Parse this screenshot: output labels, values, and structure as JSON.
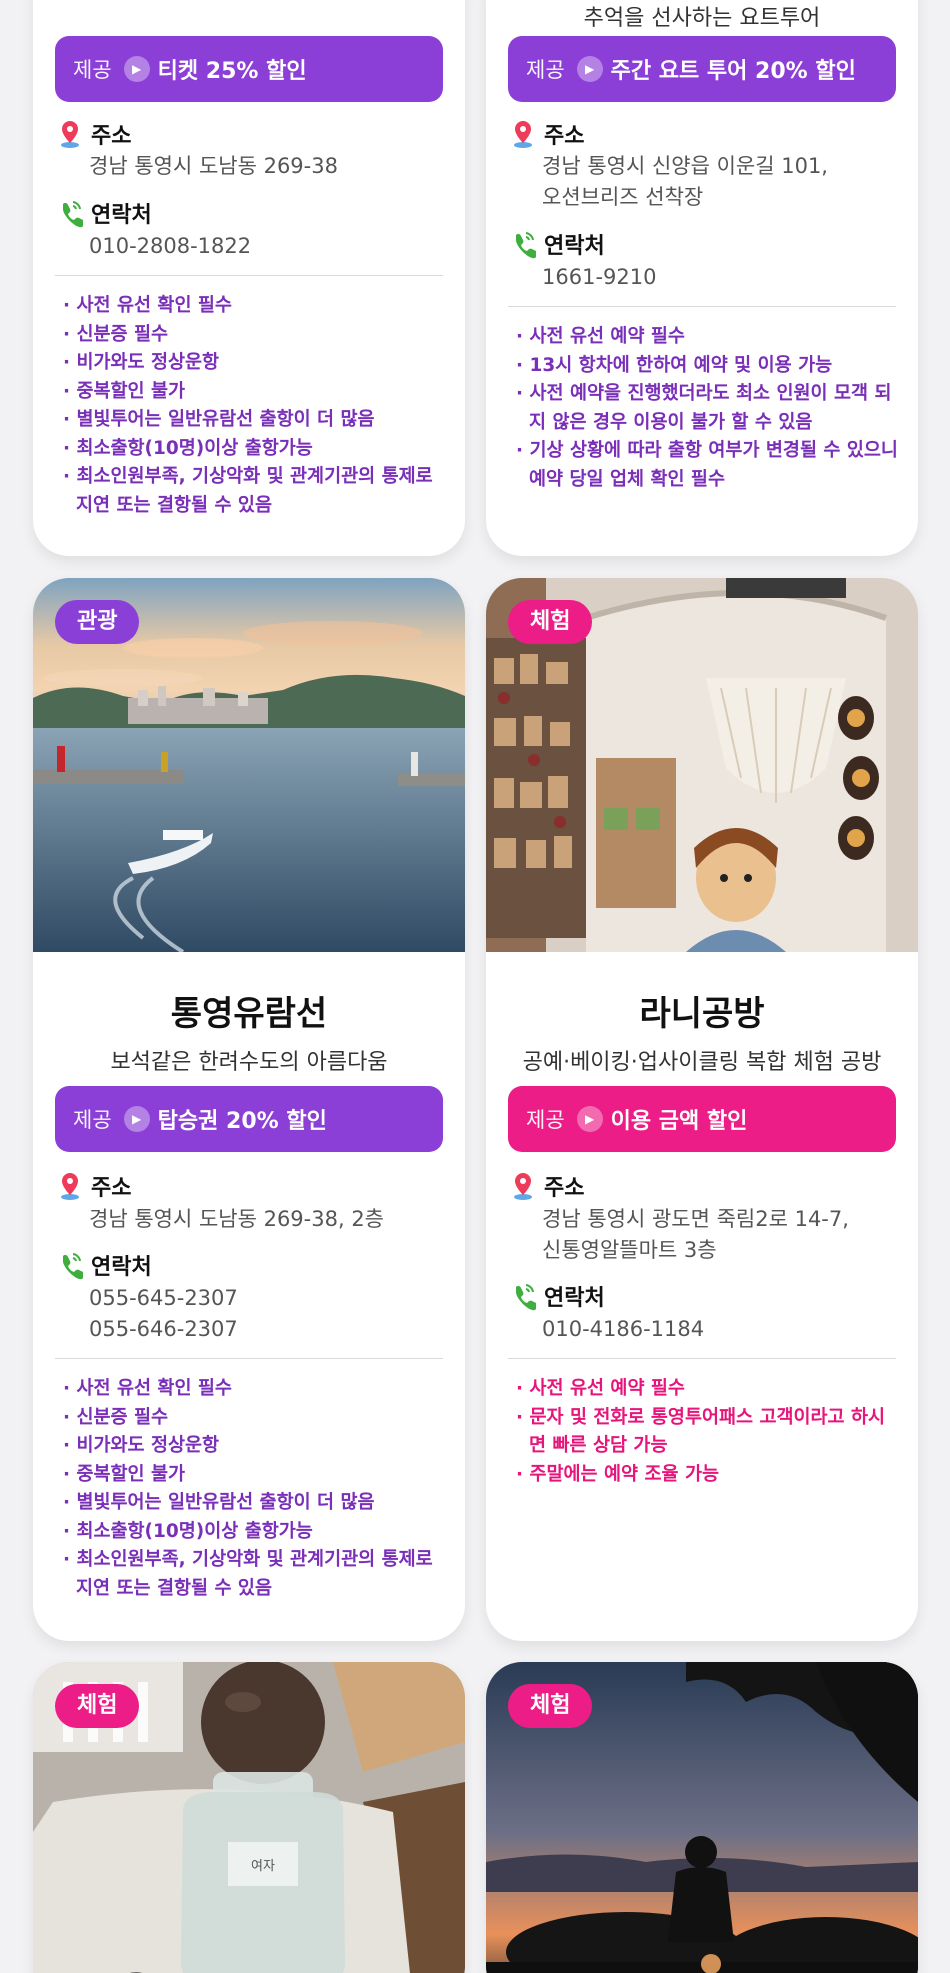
{
  "colors": {
    "purple": "#8b3fd6",
    "pink": "#ec1d87",
    "note_purple": "#7a2fb8",
    "note_pink": "#e6157c"
  },
  "labels": {
    "offer": "제공",
    "address": "주소",
    "contact": "연락처"
  },
  "cards": [
    {
      "subtitle": "추억을 선사하는 요트투어",
      "offer": "주간 요트 투어 20% 할인",
      "address": [
        "경남 통영시 신양읍 이운길 101,",
        "오션브리즈 선착장"
      ],
      "contact": [
        "1661-9210"
      ],
      "notes": [
        "사전 유선 예약 필수",
        "13시 항차에 한하여 예약 및 이용 가능",
        "사전 예약을 진행했더라도 최소 인원이 모객 되지 않은 경우 이용이 불가 할 수 있음",
        "기상 상황에 따라 출항 여부가 변경될 수 있으니 예약 당일 업체 확인 필수"
      ]
    },
    {
      "offer": "티켓 25% 할인",
      "address": [
        "경남 통영시 도남동 269-38"
      ],
      "contact": [
        "010-2808-1822"
      ],
      "notes": [
        "사전 유선 확인 필수",
        "신분증 필수",
        "비가와도 정상운항",
        "중복할인 불가",
        "별빛투어는 일반유람선 출항이 더 많음",
        "최소출항(10명)이상 출항가능",
        "최소인원부족, 기상악화 및 관계기관의 통제로 지연 또는 결항될 수 있음"
      ]
    },
    {
      "tag": "관광",
      "icon": "harbor-ferry-photo",
      "title": "통영유람선",
      "subtitle": "보석같은 한려수도의 아름다움",
      "offer": "탑승권 20% 할인",
      "address": [
        "경남 통영시 도남동 269-38, 2층"
      ],
      "contact": [
        "055-645-2307",
        "055-646-2307"
      ],
      "notes": [
        "사전 유선 확인 필수",
        "신분증 필수",
        "비가와도 정상운항",
        "중복할인 불가",
        "별빛투어는 일반유람선 출항이 더 많음",
        "최소출항(10명)이상 출항가능",
        "최소인원부족, 기상악화 및 관계기관의 통제로 지연 또는 결항될 수 있음"
      ]
    },
    {
      "tag": "체험",
      "icon": "craft-workshop-photo",
      "title": "라니공방",
      "subtitle": "공예·베이킹·업사이클링 복합 체험 공방",
      "offer": "이용 금액 할인",
      "address": [
        "경남 통영시 광도면 죽림2로 14-7,",
        "신통영알뜰마트 3층"
      ],
      "contact": [
        "010-4186-1184"
      ],
      "notes": [
        "사전 유선 예약 필수",
        "문자 및 전화로 통영투어패스 고객이라고 하시면 빠른 상담 가능",
        "주말에는 예약 조율 가능"
      ]
    },
    {
      "tag": "체험",
      "icon": "perfume-bottle-photo",
      "bottle_label": "여자"
    },
    {
      "tag": "체험",
      "icon": "sunset-silhouette-photo"
    }
  ]
}
